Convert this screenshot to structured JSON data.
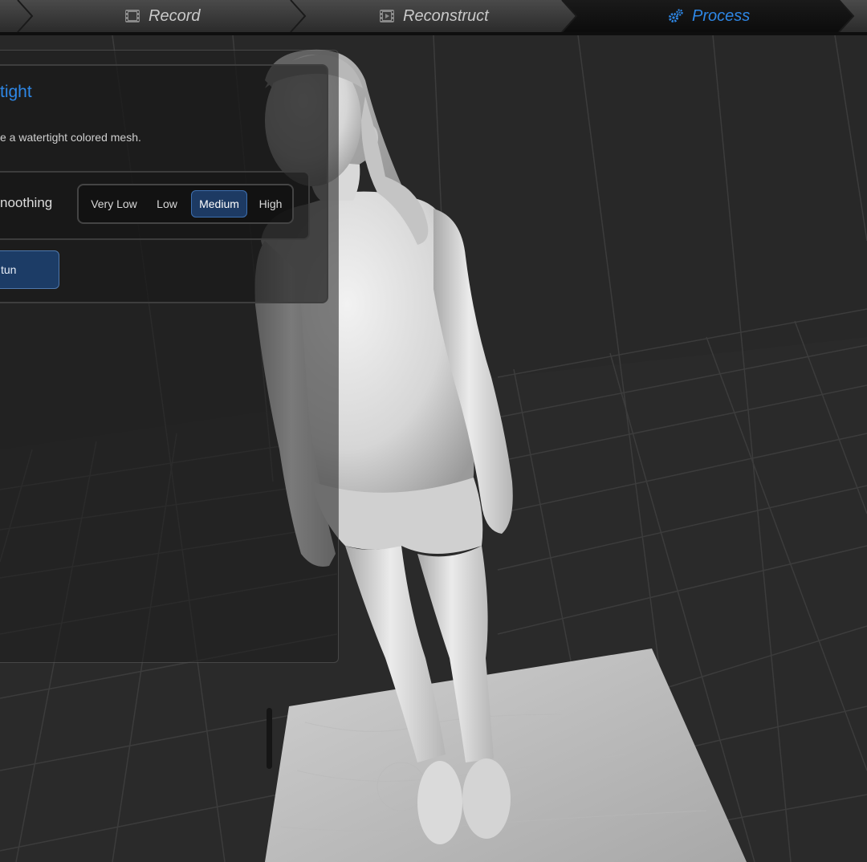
{
  "workflow_steps": [
    {
      "label": "Record",
      "icon": "film-icon",
      "active": false
    },
    {
      "label": "Reconstruct",
      "icon": "film-icon",
      "active": false
    },
    {
      "label": "Process",
      "icon": "gears-icon",
      "active": true
    }
  ],
  "panel": {
    "title": "tight",
    "description": "e a watertight colored mesh.",
    "smoothing": {
      "label": "noothing",
      "options": [
        "Very Low",
        "Low",
        "Medium",
        "High"
      ],
      "selected": "Medium"
    },
    "run_label": "tun"
  },
  "viewport": {
    "object": "3d-scanned-figure-mesh",
    "floor": "scanned-ground-patch",
    "grid": true
  },
  "colors": {
    "accent": "#2e87e6",
    "selected_bg": "#1d3a63",
    "step_text": "#c9c9c9"
  }
}
